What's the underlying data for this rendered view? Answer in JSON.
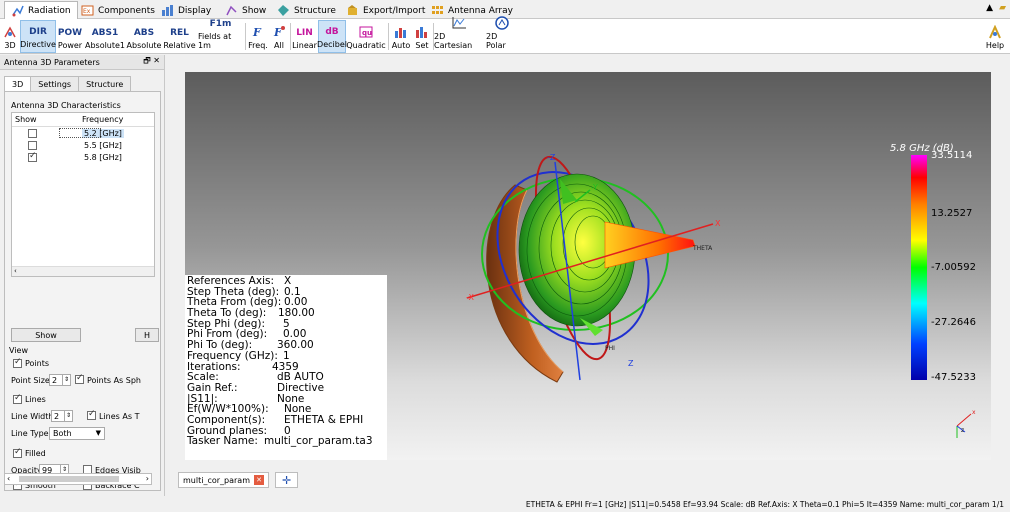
{
  "tabs": [
    {
      "label": "Radiation",
      "icon": "radiation-icon",
      "active": true
    },
    {
      "label": "Components",
      "icon": "components-icon"
    },
    {
      "label": "Display",
      "icon": "display-icon"
    },
    {
      "label": "Show",
      "icon": "show-icon"
    },
    {
      "label": "Structure",
      "icon": "structure-icon"
    },
    {
      "label": "Export/Import",
      "icon": "export-import-icon"
    },
    {
      "label": "Antenna Array",
      "icon": "antenna-array-icon"
    }
  ],
  "ribbon": {
    "btn_3d": "3D",
    "btn_directive": {
      "glyph": "DIR",
      "label": "Directive"
    },
    "btn_power": {
      "glyph": "POW",
      "label": "Power"
    },
    "btn_absolute1": {
      "glyph": "ABS1",
      "label": "Absolute1"
    },
    "btn_absolute": {
      "glyph": "ABS",
      "label": "Absolute"
    },
    "btn_relative": {
      "glyph": "REL",
      "label": "Relative"
    },
    "btn_fields": {
      "glyph": "F1m",
      "label": "Fields at 1m"
    },
    "btn_freq": {
      "label": "Freq."
    },
    "btn_all": {
      "label": "All"
    },
    "btn_linear": {
      "glyph": "LIN",
      "label": "Linear"
    },
    "btn_decibel": {
      "glyph": "dB",
      "label": "Decibel"
    },
    "btn_quadratic": {
      "label": "Quadratic"
    },
    "btn_auto": {
      "label": "Auto"
    },
    "btn_set": {
      "label": "Set"
    },
    "btn_2dcart": {
      "label": "2D Cartesian"
    },
    "btn_2dpolar": {
      "label": "2D Polar"
    },
    "btn_help": {
      "label": "Help"
    }
  },
  "left_panel": {
    "title": "Antenna 3D Parameters",
    "title_controls": "🗗 ✕",
    "tabs": [
      "3D",
      "Settings",
      "Structure"
    ],
    "group_title": "Antenna 3D Characteristics",
    "table_headers": [
      "Show",
      "Frequency"
    ],
    "rows": [
      {
        "checked": false,
        "frequency": "5.2 [GHz]",
        "selected": true
      },
      {
        "checked": false,
        "frequency": "5.5 [GHz]"
      },
      {
        "checked": true,
        "frequency": "5.8 [GHz]"
      }
    ],
    "show_button": "Show",
    "hide_button": "H",
    "view_label": "View",
    "points_label": "Points",
    "point_size_label": "Point Size:",
    "point_size_value": "2",
    "points_as_sph_label": "Points As Sph",
    "lines_label": "Lines",
    "line_width_label": "Line Width:",
    "line_width_value": "2",
    "lines_as_label": "Lines As T",
    "line_type_label": "Line Type:",
    "line_type_value": "Both",
    "filled_label": "Filled",
    "opacity_label": "Opacity:",
    "opacity_value": "99",
    "edges_label": "Edges Visib",
    "smooth_label": "Smooth",
    "backface_label": "Backface C"
  },
  "info": [
    {
      "k": "References Axis:",
      "v": "X"
    },
    {
      "k": "Step Theta (deg):",
      "v": "0.1"
    },
    {
      "k": "Theta From (deg):",
      "v": "0.00"
    },
    {
      "k": "Theta To (deg):",
      "v": "180.00"
    },
    {
      "k": "Step Phi (deg):",
      "v": "5"
    },
    {
      "k": "Phi From (deg):",
      "v": "0.00"
    },
    {
      "k": "Phi To (deg):",
      "v": "360.00"
    },
    {
      "k": "Frequency (GHz):",
      "v": "1"
    },
    {
      "k": "Iterations:",
      "v": "4359"
    },
    {
      "k": "Scale:",
      "v": "dB AUTO"
    },
    {
      "k": "Gain Ref.:",
      "v": "Directive"
    },
    {
      "k": "|S11|:",
      "v": "None"
    },
    {
      "k": "Ef(W/W*100%):",
      "v": "None"
    },
    {
      "k": "Component(s):",
      "v": "ETHETA & EPHI"
    },
    {
      "k": "Ground planes:",
      "v": "0"
    },
    {
      "k": "Tasker Name:",
      "v": "multi_cor_param.ta3"
    }
  ],
  "legend": {
    "title": "5.8 GHz (dB)",
    "max": "33.5114",
    "values": [
      "13.2527",
      "-7.00592",
      "-27.2646",
      "-47.5233"
    ]
  },
  "axes": {
    "x": "X",
    "y": "Y",
    "z": "Z",
    "theta": "THETA",
    "phi": "PHI"
  },
  "bottom_tab": "multi_cor_param",
  "status": "ETHETA & EPHI  Fr=1 [GHz]  |S11|=0.5458  Ef=93.94  Scale: dB  Ref.Axis: X  Theta=0.1  Phi=5  It=4359  Name: multi_cor_param 1/1"
}
